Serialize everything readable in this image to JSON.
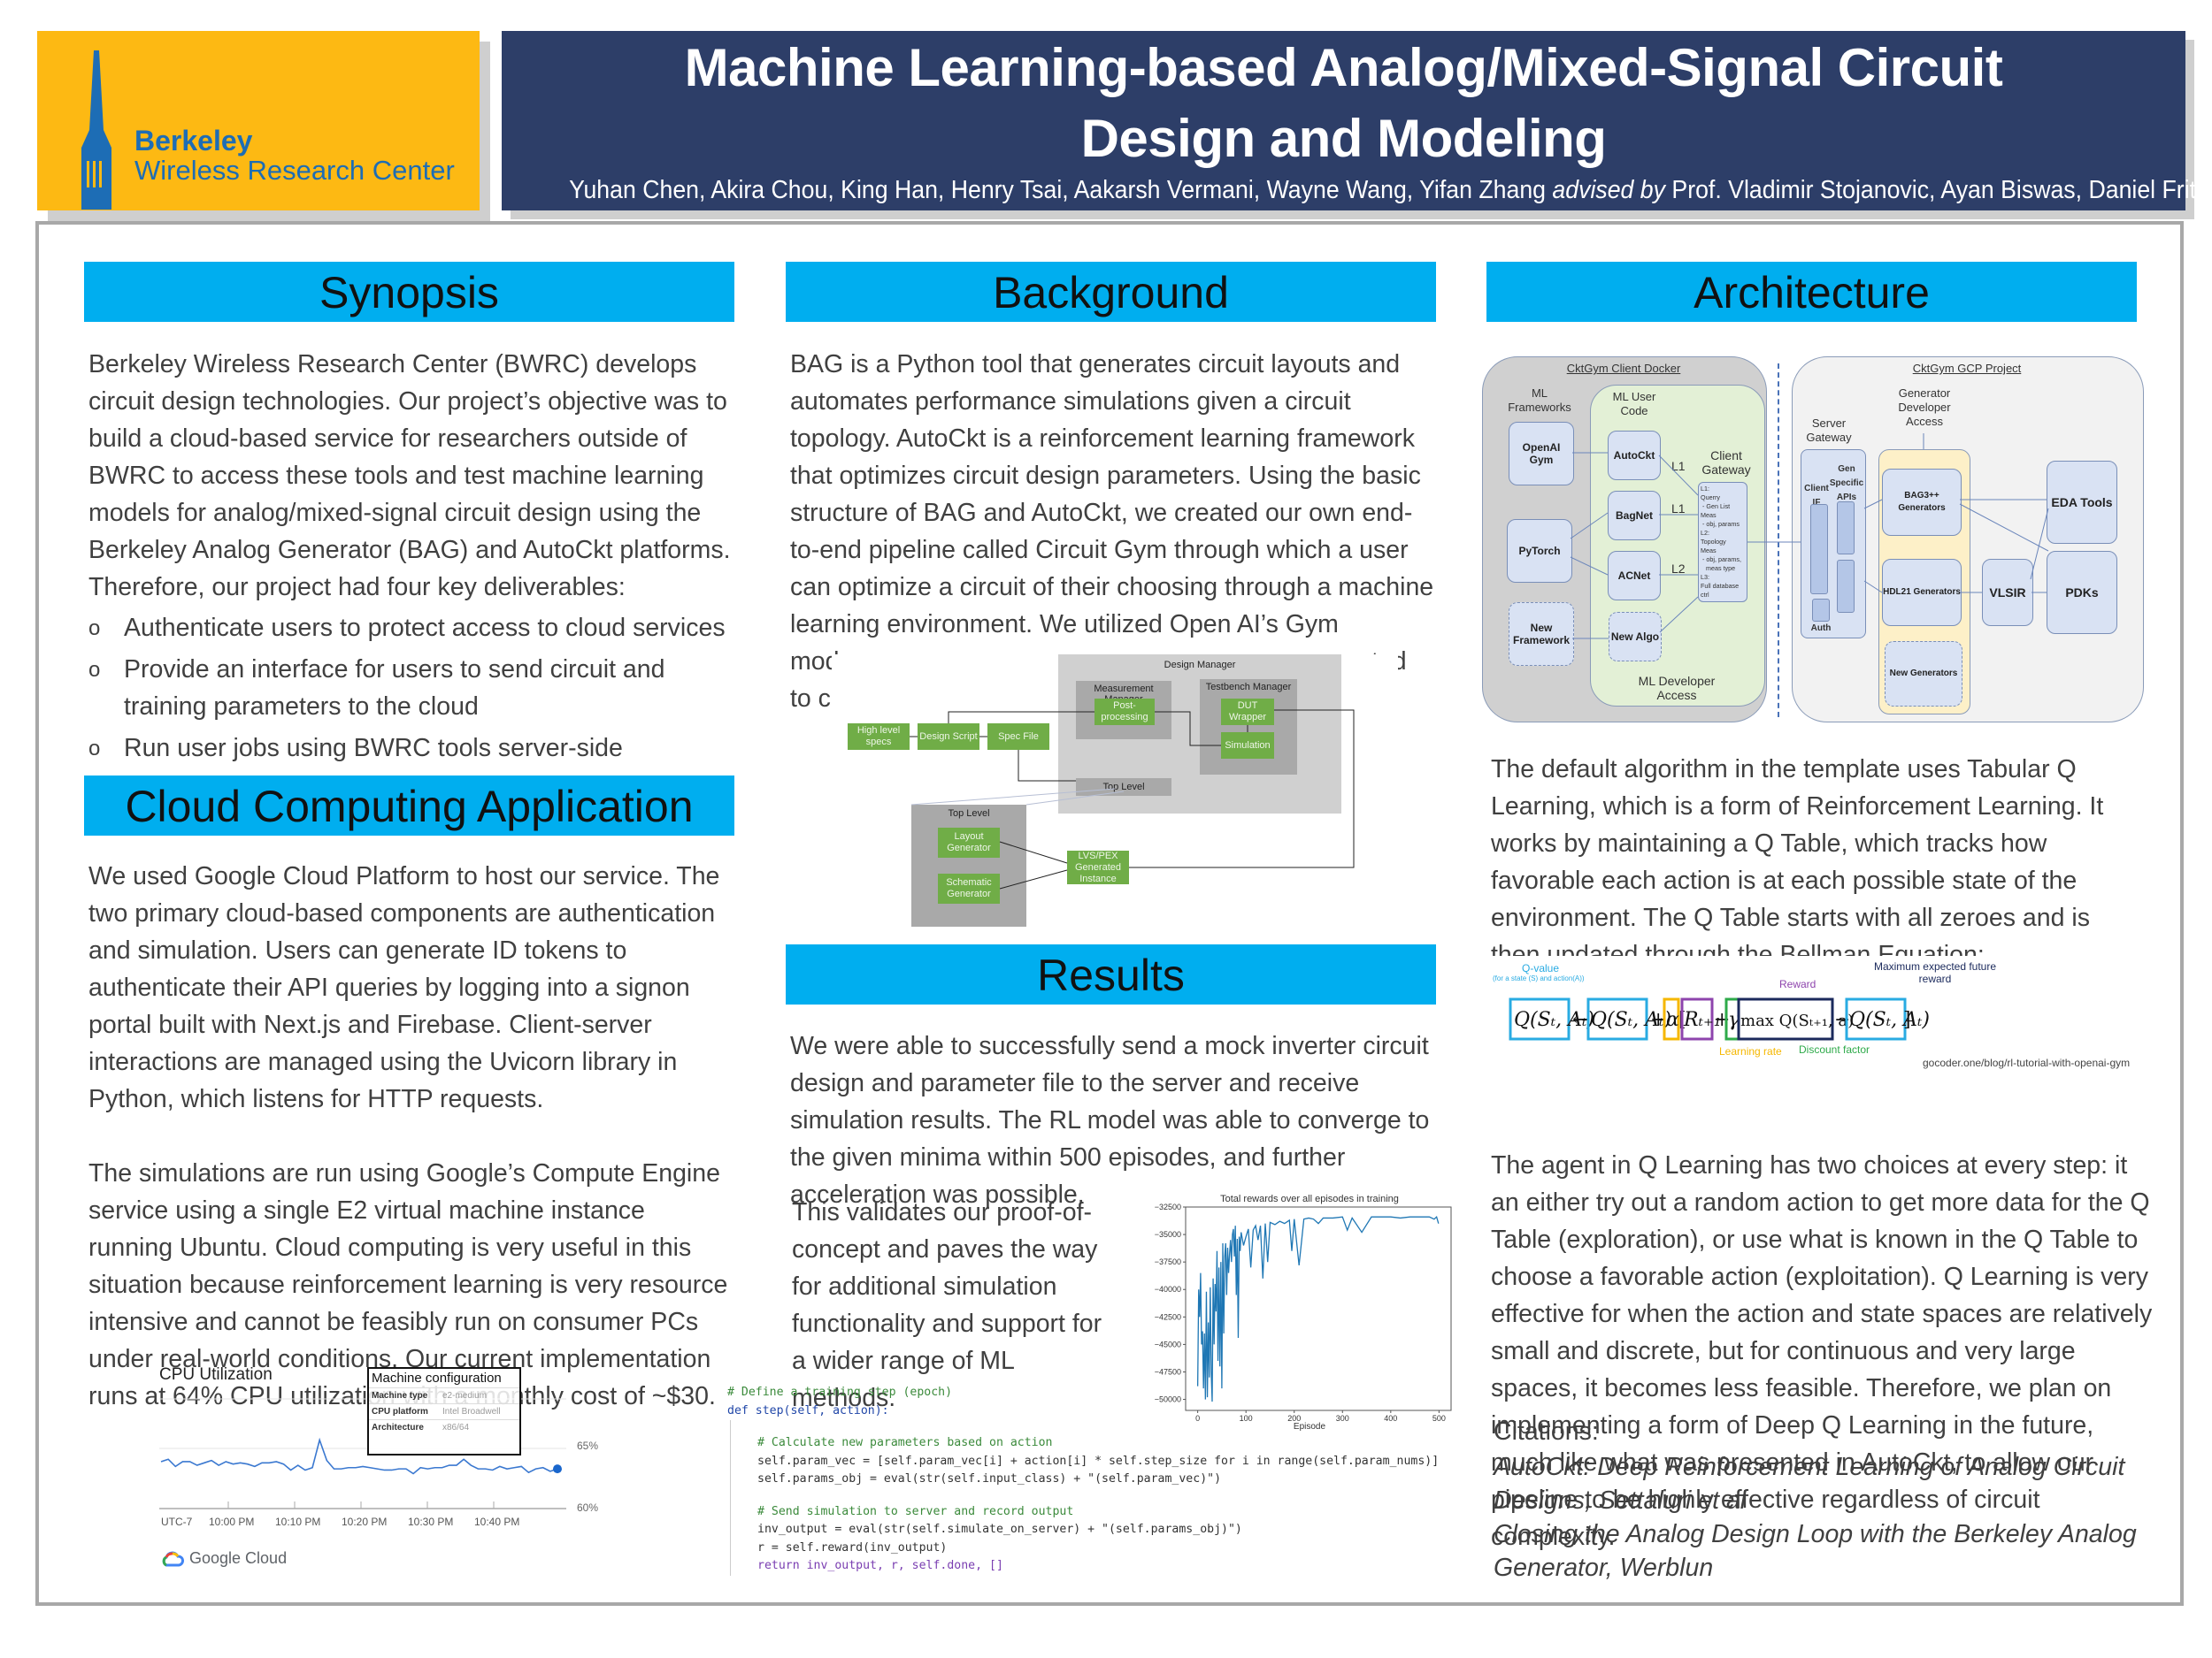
{
  "header": {
    "logo": {
      "line1": "Berkeley",
      "line2": "Wireless Research Center",
      "icon": "campanile-tower-icon"
    },
    "title_line1": "Machine Learning-based Analog/Mixed-Signal Circuit",
    "title_line2": "Design and Modeling",
    "authors": "Yuhan Chen, Akira Chou, King Han, Henry Tsai, Aakarsh Vermani, Wayne Wang, Yifan Zhang",
    "advised_by": "advised by",
    "advisors": "Prof. Vladimir Stojanovic, Ayan Biswas, Daniel Fritchman"
  },
  "colors": {
    "header_bg": "#2d3e68",
    "logo_bg": "#fdb913",
    "section_head": "#00aeef",
    "logo_text": "#1d6db5"
  },
  "synopsis": {
    "heading": "Synopsis",
    "body": "Berkeley Wireless Research Center (BWRC) develops circuit design technologies. Our project’s objective was to build a cloud-based service for researchers outside of BWRC to access these tools and test machine learning models for analog/mixed-signal circuit design using the Berkeley Analog Generator (BAG) and AutoCkt platforms. Therefore, our project had four key deliverables:",
    "bullets": [
      "Authenticate users to protect access to cloud services",
      "Provide an interface for users to send circuit and training parameters to the cloud",
      "Run user jobs using BWRC tools server-side"
    ],
    "bullet_glyph": "o"
  },
  "cloud": {
    "heading": "Cloud Computing Application",
    "para1": "We used Google Cloud Platform to host our service. The two primary cloud-based components are authentication and simulation. Users can generate ID tokens to authenticate their API queries by logging into a signon portal built with Next.js and Firebase. Client-server interactions are managed using the Uvicorn library in Python, which listens for HTTP requests.",
    "para2": "The simulations are run using Google’s Compute Engine service using a single E2 virtual machine instance running Ubuntu. Cloud computing is very useful in this situation because reinforcement learning is very resource intensive and cannot be feasibly run on consumer PCs under real-world conditions. Our current implementation runs at 64% CPU utilization with a monthly cost of ~$30.",
    "cpu_chart": {
      "title": "CPU Utilization",
      "y_labels": [
        "65%",
        "60%"
      ],
      "x_labels": [
        "UTC-7",
        "10:00 PM",
        "10:10 PM",
        "10:20 PM",
        "10:30 PM",
        "10:40 PM"
      ],
      "values": [
        63.9,
        64.1,
        63.5,
        63.9,
        63.9,
        63.6,
        63.8,
        64.0,
        63.6,
        63.9,
        63.7,
        63.8,
        63.7,
        63.5,
        63.8,
        63.8,
        63.9,
        63.7,
        63.2,
        63.6,
        63.2,
        63.4,
        65.7,
        64.0,
        63.3,
        63.3,
        63.4,
        63.4,
        63.5,
        63.4,
        63.3,
        63.2,
        63.2,
        63.3,
        63.3,
        62.9,
        63.4,
        63.3,
        63.4,
        63.4,
        63.6,
        63.6,
        64.1,
        63.6,
        63.3,
        63.3,
        63.2,
        63.5,
        63.3,
        63.4,
        63.5,
        63.0,
        63.3,
        63.4,
        63.1,
        63.3
      ],
      "brand": "Google Cloud",
      "machine_config": {
        "title": "Machine configuration",
        "rows": [
          {
            "k": "Machine type",
            "v": "e2-medium"
          },
          {
            "k": "CPU platform",
            "v": "Intel Broadwell"
          },
          {
            "k": "Architecture",
            "v": "x86/64"
          }
        ]
      }
    }
  },
  "background": {
    "heading": "Background",
    "body_visible": "BAG is a Python tool that generates circuit layouts and automates performance simulations given a circuit topology. AutoCkt is a reinforcement learning framework that optimizes circuit design parameters. Using the basic structure of BAG and AutoCkt, we created our own end-to-end pipeline called Circuit Gym through which a user can optimize a circuit of their choosing through a machine learning environment. We utilized Open AI’s Gym",
    "frag1": "modu",
    "frag2": "ted",
    "frag3": "to cir",
    "flow_diagram": {
      "design_manager": "Design Manager",
      "measurement_manager": "Measurement Manager",
      "post_processing": "Post-processing",
      "testbench_manager": "Testbench Manager",
      "dut_wrapper": "DUT Wrapper",
      "simulation": "Simulation",
      "high_level_specs": "High level specs",
      "design_script": "Design Script",
      "spec_file": "Spec File",
      "top_level": "Top Level",
      "top_level2": "Top Level",
      "layout_generator": "Layout Generator",
      "schematic_generator": "Schematic Generator",
      "lvs_pex": "LVS/PEX Generated Instance"
    }
  },
  "results": {
    "heading": "Results",
    "para1": "We were able to successfully send a mock inverter circuit design and parameter file to the server and receive simulation results. The RL model was able to converge to the given minima within 500 episodes, and further acceleration was possible.",
    "para2": "This validates our proof-of-concept and paves the way for additional simulation functionality and support for a wider range of ML methods.",
    "code": {
      "comment_header": "# Define a training step (epoch)",
      "def_line": "def step(self, action):",
      "c1": "# Calculate new parameters based on action",
      "l1": "self.param_vec = [self.param_vec[i] + action[i] * self.step_size for i in range(self.param_nums)]",
      "l2": "self.params_obj = eval(str(self.input_class) + \"(self.param_vec)\")",
      "c2": "# Send simulation to server and record output",
      "l3": "inv_output = eval(str(self.simulate_on_server) + \"(self.params_obj)\")",
      "l4": "r = self.reward(inv_output)",
      "l5": "return inv_output, r, self.done, []"
    }
  },
  "architecture": {
    "heading": "Architecture",
    "diagram": {
      "client_docker": "CktGym Client Docker",
      "gcp_project": "CktGym GCP Project",
      "ml_frameworks": "ML Frameworks",
      "ml_user_code": "ML User Code",
      "openai_gym": "OpenAI Gym",
      "pytorch": "PyTorch",
      "new_framework": "New Framework",
      "autockt": "AutoCkt",
      "bagnet": "BagNet",
      "acnet": "ACNet",
      "new_algo": "New Algo",
      "client_gateway": "Client Gateway",
      "gateway_detail": "L1:\nQuerry\n - Gen List\nMeas\n - obj, params\nL2:\nTopology\nMeas\n - obj, params,\n   meas type\nL3:\nFull database\nctrl",
      "l1a": "L1",
      "l1b": "L1",
      "l2": "L2",
      "ml_dev_access": "ML Developer Access",
      "server_gateway": "Server Gateway",
      "client_if": "Client IF",
      "gen_apis": "Gen Specific APIs",
      "auth": "Auth",
      "gen_dev_access": "Generator Developer Access",
      "bag3": "BAG3++ Generators",
      "hdl21": "HDL21 Generators",
      "new_generators": "New Generators",
      "vlsir": "VLSIR",
      "eda_tools": "EDA Tools",
      "pdks": "PDKs"
    },
    "para1": "The default algorithm in the template uses Tabular Q Learning, which is a form of Reinforcement Learning. It works by maintaining a Q Table, which tracks how favorable each action is at each possible state of the environment. The Q Table starts with all zeroes and is then updated through the Bellman Equation:",
    "bellman": {
      "q_value": "Q-value",
      "q_value_sub": "(for a state (S) and action(A))",
      "reward": "Reward",
      "max_future": "Maximum expected future reward",
      "learning_rate": "Learning rate",
      "discount": "Discount factor",
      "source": "gocoder.one/blog/rl-tutorial-with-openai-gym",
      "colors": {
        "q": "#29abe2",
        "alpha": "#f5b700",
        "reward": "#8e44ad",
        "gamma": "#2eaa4a",
        "max": "#1b2a5c"
      }
    },
    "para2": "The agent in Q Learning has two choices at every step: it an either try out a random action to get more data for the Q Table (exploration), or use what is known in the Q Table to choose a favorable action (exploitation). Q Learning is very effective for when the action and state spaces are relatively small and discrete, but for continuous and very large spaces, it becomes less feasible. Therefore, we plan on implementing a form of Deep Q Learning in the future, much like what was presented in AutoCkt, to allow our pipeline to be highly effective regardless of circuit complexity.",
    "citations_label": "Citations:",
    "citations": [
      "AutoCkt: Deep Reinforcement Learning of Analog Circuit Designs, Settaluri et al",
      "Closing the Analog Design Loop with the Berkeley Analog Generator, Werblun"
    ]
  },
  "chart_data": {
    "type": "line",
    "title": "Total rewards over all episodes in training",
    "xlabel": "Episode",
    "ylabel": "",
    "xlim": [
      -25,
      525
    ],
    "ylim": [
      -51000,
      -32500
    ],
    "xticks": [
      0,
      100,
      200,
      300,
      400,
      500
    ],
    "yticks": [
      -32500,
      -35000,
      -37500,
      -40000,
      -42500,
      -45000,
      -47500,
      -50000
    ],
    "grid": false,
    "series": [
      {
        "name": "total reward",
        "color": "#1f77b4",
        "x": [
          0,
          2,
          4,
          6,
          8,
          10,
          12,
          14,
          16,
          18,
          20,
          22,
          24,
          26,
          28,
          30,
          32,
          34,
          36,
          38,
          40,
          42,
          44,
          46,
          48,
          50,
          52,
          54,
          56,
          58,
          60,
          62,
          64,
          66,
          68,
          70,
          72,
          74,
          76,
          78,
          80,
          82,
          84,
          86,
          88,
          90,
          95,
          100,
          105,
          110,
          115,
          120,
          125,
          130,
          135,
          140,
          145,
          150,
          160,
          170,
          180,
          190,
          195,
          200,
          210,
          220,
          230,
          240,
          250,
          260,
          280,
          300,
          310,
          320,
          340,
          360,
          380,
          400,
          420,
          440,
          460,
          480,
          490,
          495,
          499
        ],
        "values": [
          -48800,
          -40000,
          -42500,
          -38500,
          -45000,
          -43800,
          -49000,
          -44000,
          -50000,
          -40200,
          -49800,
          -43000,
          -48000,
          -39800,
          -47500,
          -50200,
          -39000,
          -45000,
          -39500,
          -42000,
          -36500,
          -46500,
          -38000,
          -47000,
          -37500,
          -49000,
          -35800,
          -44000,
          -37000,
          -35800,
          -40500,
          -36200,
          -38500,
          -36800,
          -35500,
          -37500,
          -35000,
          -34500,
          -37000,
          -34200,
          -40500,
          -35400,
          -44400,
          -35200,
          -36500,
          -34800,
          -36000,
          -35200,
          -34500,
          -38000,
          -34600,
          -34200,
          -35500,
          -34200,
          -39000,
          -34000,
          -37500,
          -33900,
          -34100,
          -33800,
          -34000,
          -33700,
          -36500,
          -33600,
          -37800,
          -33600,
          -33500,
          -33600,
          -34000,
          -33500,
          -33500,
          -33400,
          -34600,
          -33500,
          -34800,
          -33400,
          -33400,
          -33400,
          -33500,
          -33400,
          -33400,
          -33400,
          -33600,
          -33400,
          -34000
        ]
      }
    ]
  }
}
